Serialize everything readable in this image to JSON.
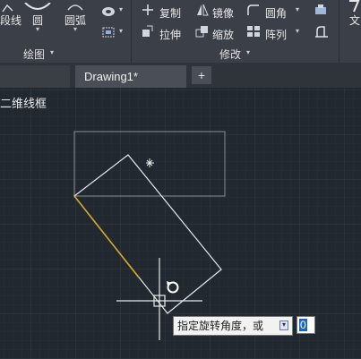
{
  "ribbon": {
    "draw_group": {
      "label": "绘图",
      "polyline_label": "段线",
      "circle_label": "圆",
      "arc_label": "圆弧"
    },
    "modify_group": {
      "label": "修改",
      "copy_label": "复制",
      "mirror_label": "镜像",
      "fillet_label": "圆角",
      "stretch_label": "拉伸",
      "scale_label": "缩放",
      "array_label": "阵列"
    },
    "text_label": "文"
  },
  "tabs": {
    "active": "Drawing1*",
    "add_label": "+"
  },
  "viewport": {
    "label": "二维线框"
  },
  "command": {
    "prompt": "指定旋转角度，或",
    "input_value": "0"
  },
  "colors": {
    "canvas_bg": "#212830",
    "rectangle_stroke": "#ffffff",
    "highlight_edge": "#d4a82a",
    "reference_box": "#8a8f96"
  }
}
